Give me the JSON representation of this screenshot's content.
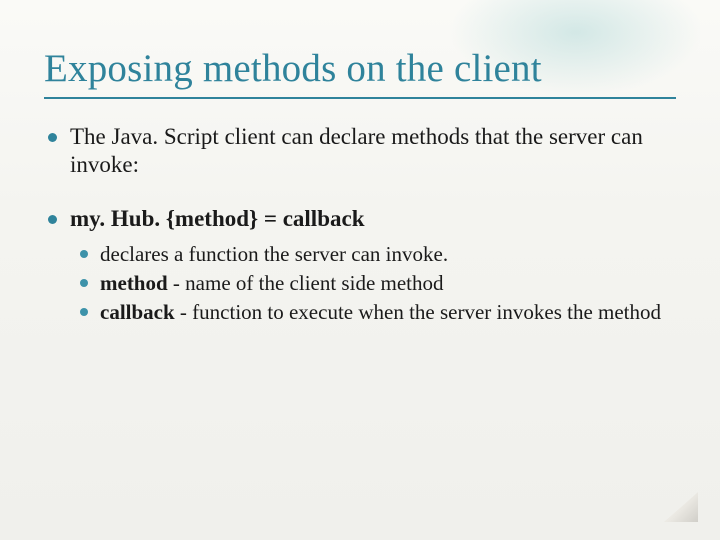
{
  "title": "Exposing methods on the client",
  "points": [
    {
      "text": "The Java. Script client can declare methods that the server can invoke:"
    },
    {
      "prefix": "my. Hub. {method} = callback",
      "bold": true,
      "sub": [
        {
          "text": "declares a function the server can invoke."
        },
        {
          "leadBold": "method",
          "rest": " - name of the client side method"
        },
        {
          "leadBold": "callback",
          "rest": " - function to execute when the server invokes the method"
        }
      ]
    }
  ]
}
